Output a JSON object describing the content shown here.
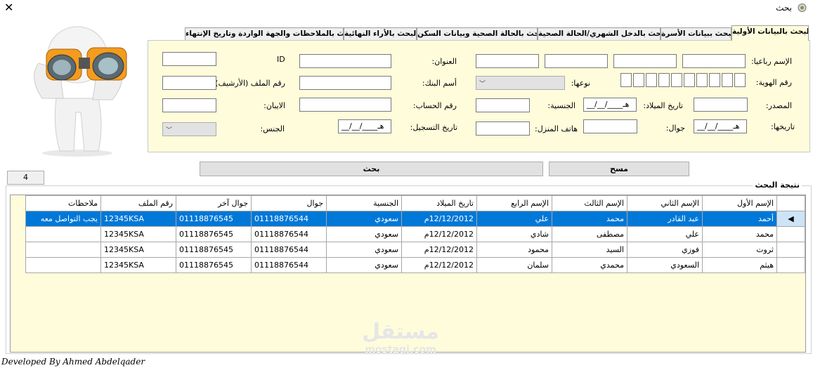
{
  "window": {
    "title": "بحث",
    "close_glyph": "✕"
  },
  "tabs": [
    "البحث بالبيانات الأولية",
    "البحث ببيانات الأسرة",
    "البحث بالدخل الشهري/الحالة الصحية",
    "البحث بالحالة الصحية وبيانات السكن",
    "البحث بالأراء النهائية",
    "البحث بالملاحظات والجهة الواردة وتاريخ الإنتهاء"
  ],
  "form": {
    "full_name_label": "الإسم رباعيا:",
    "address_label": "العنوان:",
    "id_label": "ID",
    "id_number_label": "رقم الهوية:",
    "id_type_label": "نوعها:",
    "bank_name_label": "أسم البنك:",
    "archive_no_label": "رقم الملف (الأرشيف):",
    "source_label": "المصدر:",
    "birth_date_label": "تاريخ الميلاد:",
    "nationality_label": "الجنسية:",
    "account_no_label": "رقم الحساب:",
    "iban_label": "الايبان:",
    "issue_date_label": "تاريخها:",
    "mobile_label": "جوال:",
    "home_phone_label": "هاتف المنزل:",
    "registration_date_label": "تاريخ التسجيل:",
    "gender_label": "الجنس:",
    "date_placeholder": "__/__/____هـ"
  },
  "buttons": {
    "search": "بحث",
    "clear": "مسح"
  },
  "record_count": "4",
  "results": {
    "title": "نتيجة البحث",
    "columns": [
      "الإسم الأول",
      "الإسم الثاني",
      "الإسم الثالث",
      "الإسم الرابع",
      "تاريخ الميلاد",
      "الجنسية",
      "جوال",
      "جوال آخر",
      "رقم الملف",
      "ملاحظات"
    ],
    "rows": [
      [
        "أحمد",
        "عبد القادر",
        "محمد",
        "علي",
        "12/12/2012م",
        "سعودي",
        "01118876544",
        "01118876545",
        "12345KSA",
        "يجب التواصل معه"
      ],
      [
        "محمد",
        "علي",
        "مصطفى",
        "شادي",
        "12/12/2012م",
        "سعودي",
        "01118876544",
        "01118876545",
        "12345KSA",
        ""
      ],
      [
        "ثروت",
        "فوزي",
        "السيد",
        "محمود",
        "12/12/2012م",
        "سعودي",
        "01118876544",
        "01118876545",
        "12345KSA",
        ""
      ],
      [
        "هيثم",
        "السعودي",
        "محمدي",
        "سلمان",
        "12/12/2012م",
        "سعودي",
        "01118876544",
        "01118876545",
        "12345KSA",
        ""
      ]
    ],
    "selected_row_marker": "◀"
  },
  "footer": "Developed By Ahmed Abdelqader",
  "watermark": {
    "text": "مستقل",
    "subtext": "mostaqi.com"
  }
}
